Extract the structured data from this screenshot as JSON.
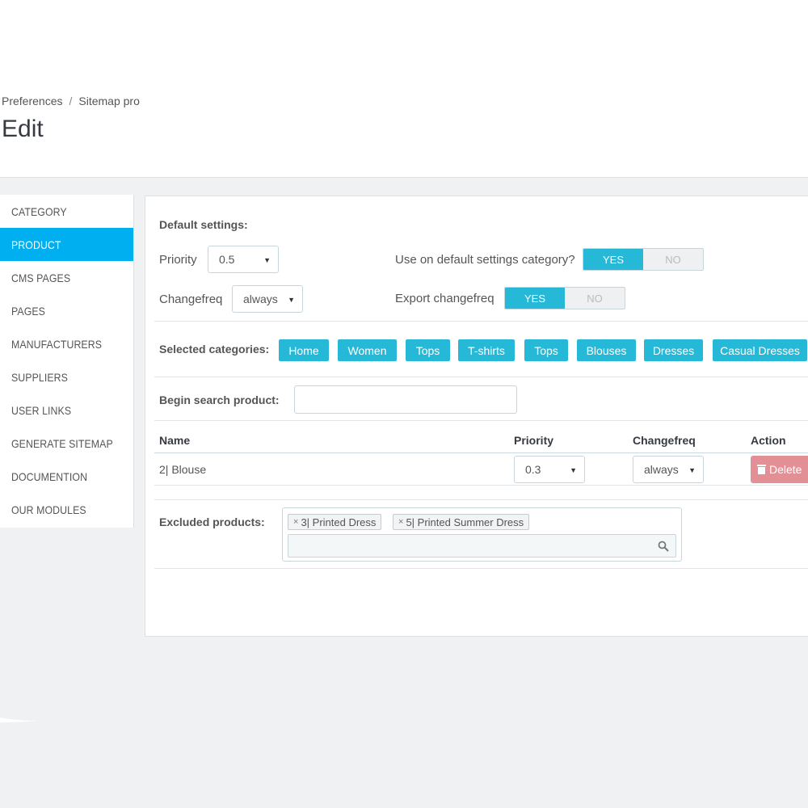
{
  "breadcrumb": {
    "item1": "Preferences",
    "separator": "/",
    "item2": "Sitemap pro"
  },
  "page_title": "Edit",
  "sidebar": {
    "items": [
      {
        "label": "CATEGORY",
        "active": false
      },
      {
        "label": "PRODUCT",
        "active": true
      },
      {
        "label": "CMS PAGES",
        "active": false
      },
      {
        "label": "PAGES",
        "active": false
      },
      {
        "label": "MANUFACTURERS",
        "active": false
      },
      {
        "label": "SUPPLIERS",
        "active": false
      },
      {
        "label": "USER LINKS",
        "active": false
      },
      {
        "label": "GENERATE SITEMAP",
        "active": false
      },
      {
        "label": "DOCUMENTION",
        "active": false
      },
      {
        "label": "OUR MODULES",
        "active": false
      }
    ]
  },
  "settings": {
    "heading": "Default settings:",
    "priority_label": "Priority",
    "priority_value": "0.5",
    "changefreq_label": "Changefreq",
    "changefreq_value": "always",
    "use_default_label": "Use on default settings category?",
    "export_changefreq_label": "Export changefreq",
    "yes_label": "YES",
    "no_label": "NO"
  },
  "categories": {
    "label": "Selected categories:",
    "tags": [
      "Home",
      "Women",
      "Tops",
      "T-shirts",
      "Tops",
      "Blouses",
      "Dresses",
      "Casual Dresses"
    ]
  },
  "search": {
    "label": "Begin search product:",
    "value": ""
  },
  "table": {
    "headers": {
      "name": "Name",
      "priority": "Priority",
      "changefreq": "Changefreq",
      "action": "Action"
    },
    "rows": [
      {
        "name": "2| Blouse",
        "priority": "0.3",
        "changefreq": "always",
        "action": "Delete"
      }
    ]
  },
  "excluded": {
    "label": "Excluded products:",
    "chips": [
      "3| Printed Dress",
      "5| Printed Summer Dress"
    ],
    "remove_glyph": "×"
  },
  "colors": {
    "accent": "#25b9d7",
    "sidebar_active": "#00aff0",
    "delete": "#e38f96",
    "background": "#eff1f2"
  },
  "icons": [
    "caret-down-icon",
    "trash-icon",
    "search-icon"
  ]
}
